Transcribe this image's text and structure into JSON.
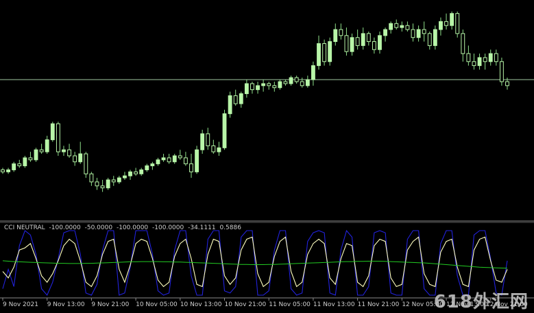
{
  "chart_data": [
    {
      "type": "candlestick",
      "title": "",
      "colors": {
        "background": "#000000",
        "bull": "#b8f5a8",
        "bear": "#b8f5a8",
        "wick": "#8fe08a",
        "hline": "#a0c8a0"
      },
      "price_range": [
        0,
        100
      ],
      "horizontal_line": 63,
      "candles": [
        [
          18,
          19,
          16,
          17
        ],
        [
          17,
          19,
          16,
          18
        ],
        [
          18,
          22,
          17,
          21
        ],
        [
          21,
          23,
          19,
          20
        ],
        [
          20,
          25,
          19,
          24
        ],
        [
          24,
          27,
          22,
          23
        ],
        [
          23,
          29,
          22,
          28
        ],
        [
          28,
          31,
          26,
          27
        ],
        [
          27,
          35,
          26,
          33
        ],
        [
          33,
          42,
          32,
          41
        ],
        [
          41,
          42,
          25,
          27
        ],
        [
          27,
          30,
          25,
          28
        ],
        [
          28,
          31,
          24,
          25
        ],
        [
          25,
          27,
          20,
          22
        ],
        [
          22,
          32,
          21,
          26
        ],
        [
          26,
          27,
          14,
          16
        ],
        [
          16,
          17,
          10,
          12
        ],
        [
          12,
          14,
          8,
          10
        ],
        [
          10,
          13,
          7,
          9
        ],
        [
          9,
          14,
          8,
          13
        ],
        [
          13,
          15,
          10,
          12
        ],
        [
          12,
          15,
          11,
          14
        ],
        [
          14,
          17,
          13,
          15
        ],
        [
          15,
          18,
          13,
          17
        ],
        [
          17,
          19,
          15,
          16
        ],
        [
          16,
          19,
          15,
          18
        ],
        [
          18,
          21,
          17,
          20
        ],
        [
          20,
          22,
          18,
          21
        ],
        [
          21,
          24,
          20,
          23
        ],
        [
          23,
          26,
          22,
          24
        ],
        [
          24,
          26,
          21,
          22
        ],
        [
          22,
          26,
          21,
          25
        ],
        [
          25,
          28,
          23,
          24
        ],
        [
          24,
          27,
          20,
          21
        ],
        [
          21,
          26,
          14,
          17
        ],
        [
          17,
          30,
          16,
          28
        ],
        [
          28,
          38,
          26,
          36
        ],
        [
          36,
          39,
          28,
          30
        ],
        [
          30,
          33,
          26,
          27
        ],
        [
          27,
          32,
          25,
          29
        ],
        [
          29,
          48,
          28,
          46
        ],
        [
          46,
          57,
          44,
          55
        ],
        [
          55,
          58,
          50,
          51
        ],
        [
          51,
          57,
          49,
          56
        ],
        [
          56,
          63,
          54,
          61
        ],
        [
          61,
          62,
          56,
          58
        ],
        [
          58,
          62,
          56,
          60
        ],
        [
          60,
          63,
          57,
          61
        ],
        [
          61,
          62,
          58,
          60
        ],
        [
          60,
          62,
          57,
          59
        ],
        [
          59,
          63,
          58,
          62
        ],
        [
          62,
          63,
          60,
          61
        ],
        [
          61,
          65,
          60,
          64
        ],
        [
          64,
          65,
          61,
          62
        ],
        [
          62,
          64,
          59,
          60
        ],
        [
          60,
          65,
          59,
          63
        ],
        [
          63,
          72,
          60,
          70
        ],
        [
          70,
          85,
          68,
          81
        ],
        [
          81,
          83,
          70,
          72
        ],
        [
          72,
          84,
          70,
          82
        ],
        [
          82,
          91,
          80,
          88
        ],
        [
          88,
          91,
          83,
          85
        ],
        [
          85,
          89,
          75,
          77
        ],
        [
          77,
          86,
          75,
          84
        ],
        [
          84,
          88,
          78,
          80
        ],
        [
          80,
          89,
          78,
          86
        ],
        [
          86,
          87,
          80,
          82
        ],
        [
          82,
          84,
          76,
          78
        ],
        [
          78,
          87,
          76,
          85
        ],
        [
          85,
          89,
          82,
          88
        ],
        [
          88,
          92,
          86,
          91
        ],
        [
          91,
          93,
          88,
          89
        ],
        [
          89,
          92,
          87,
          90
        ],
        [
          90,
          92,
          87,
          88
        ],
        [
          88,
          91,
          82,
          84
        ],
        [
          84,
          90,
          82,
          88
        ],
        [
          88,
          92,
          82,
          86
        ],
        [
          86,
          87,
          78,
          80
        ],
        [
          80,
          90,
          78,
          88
        ],
        [
          88,
          94,
          85,
          92
        ],
        [
          92,
          96,
          88,
          90
        ],
        [
          90,
          97,
          88,
          96
        ],
        [
          96,
          97,
          84,
          86
        ],
        [
          86,
          88,
          72,
          76
        ],
        [
          76,
          80,
          70,
          72
        ],
        [
          72,
          76,
          68,
          70
        ],
        [
          70,
          76,
          68,
          74
        ],
        [
          74,
          76,
          68,
          72
        ],
        [
          72,
          78,
          70,
          76
        ],
        [
          76,
          78,
          70,
          72
        ],
        [
          72,
          74,
          60,
          62
        ],
        [
          62,
          64,
          58,
          60
        ]
      ]
    },
    {
      "type": "line",
      "title": "CCI NEUTRAL -100.0000 -50.0000 -100.0000 -100.0000 -34.1111 0.5886",
      "label_parts": [
        "CCI NEUTRAL",
        "-100.0000",
        "-50.0000",
        "-100.0000",
        "-100.0000",
        "-34.1111",
        "0.5886"
      ],
      "ylim": [
        -150,
        150
      ],
      "series": [
        {
          "color": "#2222dd",
          "values": [
            -120,
            -30,
            -110,
            80,
            150,
            130,
            40,
            -120,
            -150,
            -90,
            20,
            140,
            150,
            150,
            40,
            -140,
            -150,
            -100,
            60,
            150,
            150,
            -150,
            -140,
            -20,
            150,
            150,
            150,
            40,
            -130,
            -150,
            -140,
            60,
            150,
            150,
            -60,
            -150,
            -150,
            110,
            150,
            150,
            -130,
            -140,
            -110,
            120,
            150,
            150,
            -150,
            -150,
            -130,
            60,
            150,
            150,
            -120,
            -150,
            -140,
            100,
            140,
            150,
            140,
            -140,
            -150,
            60,
            150,
            120,
            -150,
            -150,
            -110,
            140,
            150,
            140,
            -140,
            -150,
            -150,
            110,
            150,
            150,
            -120,
            -150,
            -150,
            90,
            150,
            150,
            -60,
            -150,
            -150,
            130,
            150,
            150,
            20,
            -140,
            -150,
            10
          ]
        },
        {
          "color": "#ffffc0",
          "values": [
            -40,
            -70,
            -20,
            60,
            70,
            90,
            20,
            -60,
            -90,
            -50,
            10,
            80,
            110,
            90,
            10,
            -90,
            -110,
            -60,
            40,
            100,
            110,
            -30,
            -90,
            -10,
            90,
            110,
            100,
            20,
            -80,
            -110,
            -90,
            30,
            90,
            110,
            20,
            -100,
            -110,
            40,
            110,
            100,
            -60,
            -100,
            -70,
            60,
            110,
            120,
            -50,
            -110,
            -90,
            30,
            100,
            120,
            -40,
            -110,
            -90,
            40,
            90,
            110,
            90,
            -70,
            -100,
            20,
            90,
            80,
            -90,
            -110,
            -60,
            80,
            110,
            100,
            -70,
            -110,
            -100,
            60,
            100,
            120,
            -50,
            -100,
            -110,
            50,
            100,
            110,
            -20,
            -100,
            -110,
            60,
            110,
            120,
            10,
            -80,
            -90,
            -30
          ]
        },
        {
          "color": "#22cc22",
          "values": [
            10,
            8,
            6,
            5,
            4,
            3,
            2,
            1,
            0,
            -1,
            -2,
            -2,
            -3,
            -3,
            -3,
            -2,
            -2,
            -1,
            0,
            1,
            2,
            3,
            4,
            5,
            5,
            6,
            6,
            6,
            6,
            5,
            5,
            4,
            4,
            3,
            2,
            1,
            0,
            -1,
            -2,
            -3,
            -4,
            -5,
            -6,
            -7,
            -7,
            -8,
            -8,
            -8,
            -7,
            -7,
            -6,
            -5,
            -4,
            -3,
            -2,
            -1,
            0,
            1,
            2,
            3,
            4,
            5,
            6,
            6,
            7,
            7,
            8,
            8,
            8,
            7,
            6,
            5,
            4,
            3,
            2,
            1,
            0,
            -2,
            -4,
            -6,
            -8,
            -10,
            -12,
            -14,
            -16,
            -18,
            -20,
            -21,
            -22,
            -23,
            -24,
            -25
          ]
        }
      ]
    }
  ],
  "time_axis": {
    "ticks": [
      {
        "label": "9 Nov 2021",
        "index": 0
      },
      {
        "label": "9 Nov 13:00",
        "index": 8
      },
      {
        "label": "9 Nov 21:00",
        "index": 16
      },
      {
        "label": "10 Nov 05:00",
        "index": 24
      },
      {
        "label": "10 Nov 13:00",
        "index": 32
      },
      {
        "label": "10 Nov 21:00",
        "index": 40
      },
      {
        "label": "11 Nov 05:00",
        "index": 48
      },
      {
        "label": "11 Nov 13:00",
        "index": 56
      },
      {
        "label": "11 Nov 21:00",
        "index": 64
      },
      {
        "label": "12 Nov 05:00",
        "index": 72
      },
      {
        "label": "12 Nov 13:00",
        "index": 80
      },
      {
        "label": "12 Nov 21:00",
        "index": 88
      }
    ]
  },
  "watermark": "618外汇网"
}
